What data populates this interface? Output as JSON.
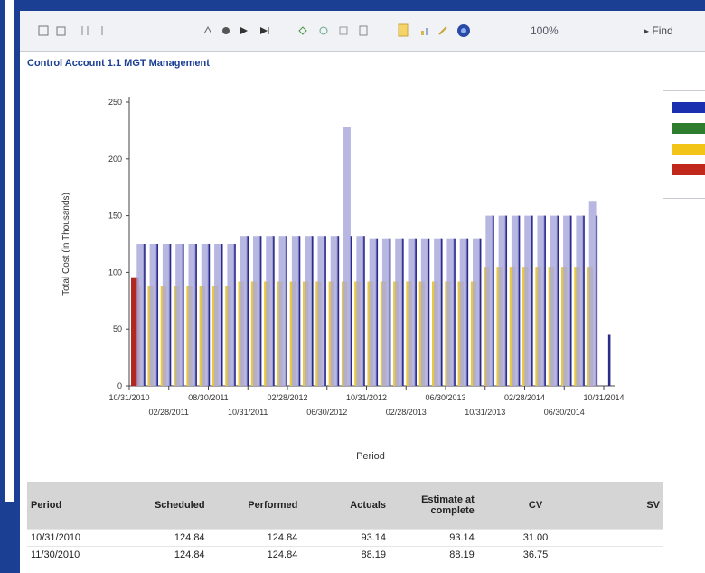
{
  "toolbar": {
    "zoom": "100%",
    "find": "Find",
    "icons": [
      "page-first-icon",
      "page-prev-icon",
      "page-next-icon",
      "page-last-icon",
      "refresh-icon",
      "stop-icon",
      "back-icon",
      "print-icon",
      "print-layout-icon",
      "page-setup-icon",
      "export-icon",
      "help-icon",
      "globe-icon"
    ]
  },
  "report": {
    "title": "Control Account 1.1 MGT Management"
  },
  "chart_data": {
    "type": "bar",
    "xlabel": "Period",
    "ylabel": "Total Cost (in Thousands)",
    "ylim": [
      0,
      250
    ],
    "y_ticks": [
      "0",
      "50",
      "100",
      "150",
      "200",
      "250"
    ],
    "x_tick_labels_row1": [
      "10/31/2010",
      "08/30/2011",
      "02/28/2012",
      "10/31/2012",
      "06/30/2013",
      "02/28/2014",
      "10/31/2014"
    ],
    "x_tick_labels_row2": [
      "02/28/2011",
      "10/31/2011",
      "06/30/2012",
      "02/28/2013",
      "10/31/2013",
      "06/30/2014"
    ],
    "legend": "right",
    "series": [
      {
        "name": "",
        "color": "#2a2a8a",
        "values": [
          125,
          125,
          125,
          125,
          125,
          125,
          125,
          125,
          132,
          132,
          132,
          132,
          132,
          132,
          132,
          132,
          132,
          132,
          130,
          130,
          130,
          130,
          130,
          130,
          130,
          130,
          130,
          150,
          150,
          150,
          150,
          150,
          150,
          150,
          150,
          150,
          45
        ]
      },
      {
        "name": "",
        "color": "#3a8a3a",
        "values": []
      },
      {
        "name": "",
        "color": "#e8c840",
        "values": [
          88,
          88,
          88,
          88,
          88,
          88,
          88,
          88,
          92,
          92,
          92,
          92,
          92,
          92,
          92,
          92,
          92,
          92,
          92,
          92,
          92,
          92,
          92,
          92,
          92,
          92,
          92,
          105,
          105,
          105,
          105,
          105,
          105,
          105,
          105,
          105,
          0
        ]
      },
      {
        "name": "",
        "color": "#b02820",
        "values": [
          95,
          0,
          0,
          0,
          0,
          0,
          0,
          0,
          0,
          0,
          0,
          0,
          0,
          0,
          0,
          0,
          0,
          0,
          0,
          0,
          0,
          0,
          0,
          0,
          0,
          0,
          0,
          0,
          0,
          0,
          0,
          0,
          0,
          0,
          0,
          0,
          0
        ]
      },
      {
        "name": "",
        "color": "#aaaadd",
        "values": [
          125,
          125,
          125,
          125,
          125,
          125,
          125,
          125,
          132,
          132,
          132,
          132,
          132,
          132,
          132,
          132,
          228,
          132,
          130,
          130,
          130,
          130,
          130,
          130,
          130,
          130,
          130,
          150,
          150,
          150,
          150,
          150,
          150,
          150,
          150,
          163,
          0
        ]
      }
    ]
  },
  "legend_colors": [
    "#1a2fb0",
    "#2e7d2e",
    "#f2c418",
    "#c0281c"
  ],
  "table": {
    "headers": [
      "Period",
      "Scheduled",
      "Performed",
      "Actuals",
      "Estimate at complete",
      "CV",
      "SV"
    ],
    "rows": [
      [
        "10/31/2010",
        "124.84",
        "124.84",
        "93.14",
        "93.14",
        "31.00",
        ""
      ],
      [
        "11/30/2010",
        "124.84",
        "124.84",
        "88.19",
        "88.19",
        "36.75",
        ""
      ]
    ]
  }
}
